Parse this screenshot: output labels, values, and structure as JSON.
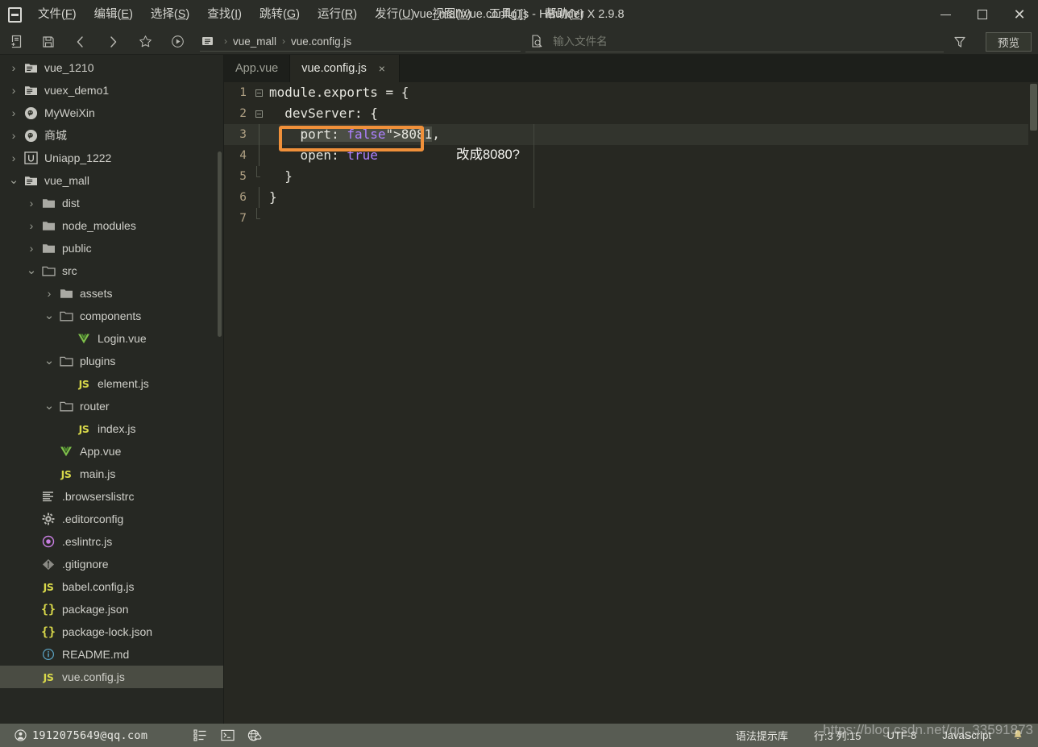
{
  "window": {
    "title": "vue_mall/vue.config.js - HBuilder X 2.9.8",
    "minimize": "minimize-icon",
    "maximize": "maximize-icon",
    "close": "close-icon"
  },
  "menubar": {
    "items": [
      {
        "label": "文件(F)",
        "mnemonic": "F"
      },
      {
        "label": "编辑(E)",
        "mnemonic": "E"
      },
      {
        "label": "选择(S)",
        "mnemonic": "S"
      },
      {
        "label": "查找(I)",
        "mnemonic": "I"
      },
      {
        "label": "跳转(G)",
        "mnemonic": "G"
      },
      {
        "label": "运行(R)",
        "mnemonic": "R"
      },
      {
        "label": "发行(U)",
        "mnemonic": "U"
      },
      {
        "label": "视图(V)",
        "mnemonic": "V"
      },
      {
        "label": "工具(T)",
        "mnemonic": "T"
      },
      {
        "label": "帮助(Y)",
        "mnemonic": "Y"
      }
    ]
  },
  "toolbar": {
    "buttons": [
      "new-file-icon",
      "save-icon",
      "back-arrow-icon",
      "forward-arrow-icon",
      "star-icon",
      "run-icon"
    ],
    "breadcrumb": {
      "icon": "folder-file-icon",
      "parts": [
        "vue_mall",
        "vue.config.js"
      ],
      "separator": "›"
    },
    "file_search": {
      "icon": "file-search-icon",
      "placeholder": "输入文件名",
      "value": ""
    },
    "filter_icon": "filter-icon",
    "preview_label": "预览"
  },
  "sidebar": {
    "items": [
      {
        "label": "vue_1210",
        "indent": 0,
        "arrow": "right",
        "icon": "folder-project-icon",
        "selected": false
      },
      {
        "label": "vuex_demo1",
        "indent": 0,
        "arrow": "right",
        "icon": "folder-project-icon",
        "selected": false
      },
      {
        "label": "MyWeiXin",
        "indent": 0,
        "arrow": "right",
        "icon": "wechat-project-icon",
        "selected": false
      },
      {
        "label": "商城",
        "indent": 0,
        "arrow": "right",
        "icon": "wechat-project-icon",
        "selected": false
      },
      {
        "label": "Uniapp_1222",
        "indent": 0,
        "arrow": "right",
        "icon": "uniapp-project-icon",
        "selected": false
      },
      {
        "label": "vue_mall",
        "indent": 0,
        "arrow": "down",
        "icon": "folder-project-icon",
        "selected": false
      },
      {
        "label": "dist",
        "indent": 1,
        "arrow": "right",
        "icon": "folder-closed-icon",
        "selected": false
      },
      {
        "label": "node_modules",
        "indent": 1,
        "arrow": "right",
        "icon": "folder-closed-icon",
        "selected": false
      },
      {
        "label": "public",
        "indent": 1,
        "arrow": "right",
        "icon": "folder-closed-icon",
        "selected": false
      },
      {
        "label": "src",
        "indent": 1,
        "arrow": "down",
        "icon": "folder-open-icon",
        "selected": false
      },
      {
        "label": "assets",
        "indent": 2,
        "arrow": "right",
        "icon": "folder-closed-icon",
        "selected": false
      },
      {
        "label": "components",
        "indent": 2,
        "arrow": "down",
        "icon": "folder-open-icon",
        "selected": false
      },
      {
        "label": "Login.vue",
        "indent": 3,
        "arrow": "none",
        "icon": "vue-file-icon",
        "selected": false
      },
      {
        "label": "plugins",
        "indent": 2,
        "arrow": "down",
        "icon": "folder-open-icon",
        "selected": false
      },
      {
        "label": "element.js",
        "indent": 3,
        "arrow": "none",
        "icon": "js-file-icon",
        "selected": false
      },
      {
        "label": "router",
        "indent": 2,
        "arrow": "down",
        "icon": "folder-open-icon",
        "selected": false
      },
      {
        "label": "index.js",
        "indent": 3,
        "arrow": "none",
        "icon": "js-file-icon",
        "selected": false
      },
      {
        "label": "App.vue",
        "indent": 2,
        "arrow": "none",
        "icon": "vue-file-icon",
        "selected": false
      },
      {
        "label": "main.js",
        "indent": 2,
        "arrow": "none",
        "icon": "js-file-icon",
        "selected": false
      },
      {
        "label": ".browserslistrc",
        "indent": 1,
        "arrow": "none",
        "icon": "text-lines-icon",
        "selected": false
      },
      {
        "label": ".editorconfig",
        "indent": 1,
        "arrow": "none",
        "icon": "gear-icon",
        "selected": false
      },
      {
        "label": ".eslintrc.js",
        "indent": 1,
        "arrow": "none",
        "icon": "eslint-icon",
        "selected": false
      },
      {
        "label": ".gitignore",
        "indent": 1,
        "arrow": "none",
        "icon": "git-icon",
        "selected": false
      },
      {
        "label": "babel.config.js",
        "indent": 1,
        "arrow": "none",
        "icon": "js-file-icon",
        "selected": false
      },
      {
        "label": "package.json",
        "indent": 1,
        "arrow": "none",
        "icon": "json-file-icon",
        "selected": false
      },
      {
        "label": "package-lock.json",
        "indent": 1,
        "arrow": "none",
        "icon": "json-file-icon",
        "selected": false
      },
      {
        "label": "README.md",
        "indent": 1,
        "arrow": "none",
        "icon": "info-icon",
        "selected": false
      },
      {
        "label": "vue.config.js",
        "indent": 1,
        "arrow": "none",
        "icon": "js-file-icon",
        "selected": true
      }
    ]
  },
  "tabs": [
    {
      "label": "App.vue",
      "active": false,
      "closable": false
    },
    {
      "label": "vue.config.js",
      "active": true,
      "closable": true,
      "close": "×"
    }
  ],
  "editor": {
    "lines": [
      {
        "num": "1",
        "fold": "minus",
        "text": "module.exports = {"
      },
      {
        "num": "2",
        "fold": "minus",
        "text": "  devServer: {"
      },
      {
        "num": "3",
        "fold": "bar",
        "text": "    port: 8081,",
        "current": true
      },
      {
        "num": "4",
        "fold": "bar",
        "text": "    open: true"
      },
      {
        "num": "5",
        "fold": "barend",
        "text": "  }"
      },
      {
        "num": "6",
        "fold": "bar",
        "text": "}"
      },
      {
        "num": "7",
        "fold": "barend",
        "text": ""
      }
    ],
    "annotation": "改成8080?",
    "highlight_color": "#f0903a",
    "selected_text": "port: 8081,"
  },
  "statusbar": {
    "account_icon": "user-circle-icon",
    "account": "1912075649@qq.com",
    "left_icons": [
      "list-icon",
      "terminal-icon",
      "globe-cloud-icon"
    ],
    "right_cells": [
      "语法提示库",
      "行:3  列:15",
      "UTF-8",
      "JavaScript"
    ],
    "bell_icon": "bell-icon",
    "watermark": "https://blog.csdn.net/qq_33591873"
  }
}
